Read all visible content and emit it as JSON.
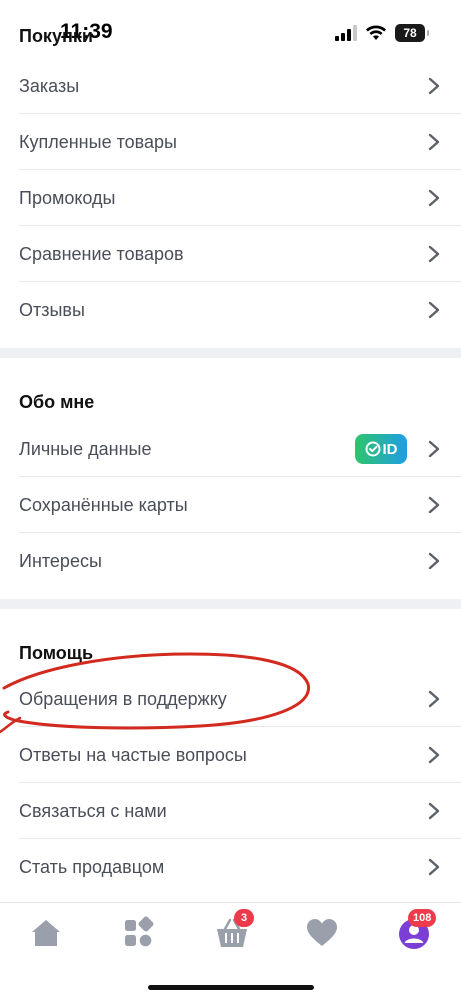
{
  "status": {
    "time": "11:39",
    "battery": "78"
  },
  "purchases": {
    "title": "Покупки",
    "items": [
      {
        "label": "Заказы"
      },
      {
        "label": "Купленные товары"
      },
      {
        "label": "Промокоды"
      },
      {
        "label": "Сравнение товаров"
      },
      {
        "label": "Отзывы"
      }
    ]
  },
  "about": {
    "title": "Обо мне",
    "items": [
      {
        "label": "Личные данные",
        "badge": "ID"
      },
      {
        "label": "Сохранённые карты"
      },
      {
        "label": "Интересы"
      }
    ]
  },
  "help": {
    "title": "Помощь",
    "items": [
      {
        "label": "Обращения в поддержку"
      },
      {
        "label": "Ответы на частые вопросы"
      },
      {
        "label": "Связаться с нами"
      },
      {
        "label": "Стать продавцом"
      }
    ]
  },
  "tabbar": {
    "cart_count": "3",
    "profile_count": "108",
    "icon_color": "#9aa0ab",
    "profile_color": "#7b3fd6"
  },
  "colors": {
    "annotation": "#d32a1f",
    "badge": "#ee3b4b"
  }
}
